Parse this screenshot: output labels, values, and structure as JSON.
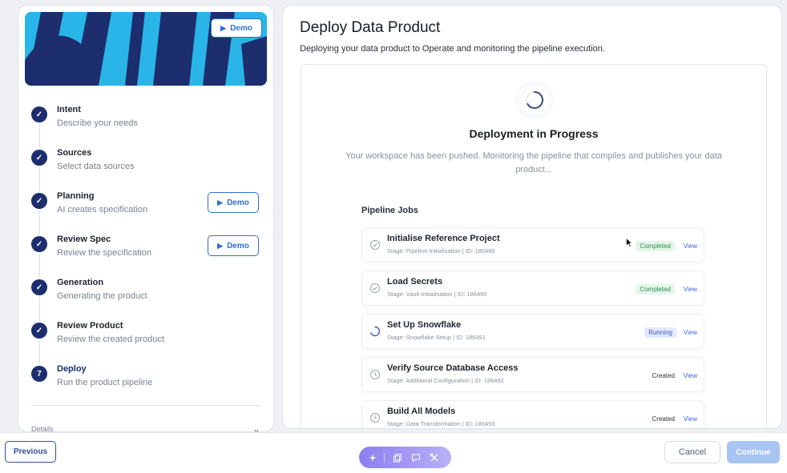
{
  "sidebar": {
    "banner_demo_label": "Demo",
    "steps": [
      {
        "marker": "✓",
        "title": "Intent",
        "subtitle": "Describe your needs"
      },
      {
        "marker": "✓",
        "title": "Sources",
        "subtitle": "Select data sources"
      },
      {
        "marker": "✓",
        "title": "Planning",
        "subtitle": "AI creates specification",
        "demo_label": "Demo"
      },
      {
        "marker": "✓",
        "title": "Review Spec",
        "subtitle": "Review the specification",
        "demo_label": "Demo"
      },
      {
        "marker": "✓",
        "title": "Generation",
        "subtitle": "Generating the product"
      },
      {
        "marker": "✓",
        "title": "Review Product",
        "subtitle": "Review the created product"
      },
      {
        "marker": "7",
        "title": "Deploy",
        "subtitle": "Run the product pipeline"
      }
    ],
    "details_label": "Details"
  },
  "main": {
    "title": "Deploy Data Product",
    "subtitle": "Deploying your data product to Operate and monitoring the pipeline execution.",
    "progress_title": "Deployment in Progress",
    "progress_description": "Your workspace has been pushed. Monitoring the pipeline that compiles and publishes your data product...",
    "jobs_label": "Pipeline Jobs",
    "jobs": [
      {
        "name": "Initialise Reference Project",
        "meta": "Stage: Pipeline Initialisation | ID: 186489",
        "status": "Completed",
        "status_kind": "completed",
        "view": "View"
      },
      {
        "name": "Load Secrets",
        "meta": "Stage: Vault Initialisation | ID: 186490",
        "status": "Completed",
        "status_kind": "completed",
        "view": "View"
      },
      {
        "name": "Set Up Snowflake",
        "meta": "Stage: Snowflake Setup | ID: 186491",
        "status": "Running",
        "status_kind": "running",
        "view": "View"
      },
      {
        "name": "Verify Source Database Access",
        "meta": "Stage: Additional Configuration | ID: 186492",
        "status": "Created",
        "status_kind": "created",
        "view": "View"
      },
      {
        "name": "Build All Models",
        "meta": "Stage: Data Transformation | ID: 186493",
        "status": "Created",
        "status_kind": "created",
        "view": "View"
      }
    ]
  },
  "footer": {
    "previous_label": "Previous",
    "cancel_label": "Cancel",
    "continue_label": "Continue",
    "toolbar_icons": [
      "sparkle-icon",
      "copy-icon",
      "comment-icon",
      "tools-icon"
    ]
  },
  "colors": {
    "primary_navy": "#1c2e6e",
    "accent_blue": "#2f6fd6",
    "banner_cyan": "#29b5e8",
    "completed_green": "#2f8a4f",
    "running_blue": "#3a56c4",
    "toolbar_purple": "#8c7ef0",
    "continue_disabled": "#a7c4f2"
  }
}
